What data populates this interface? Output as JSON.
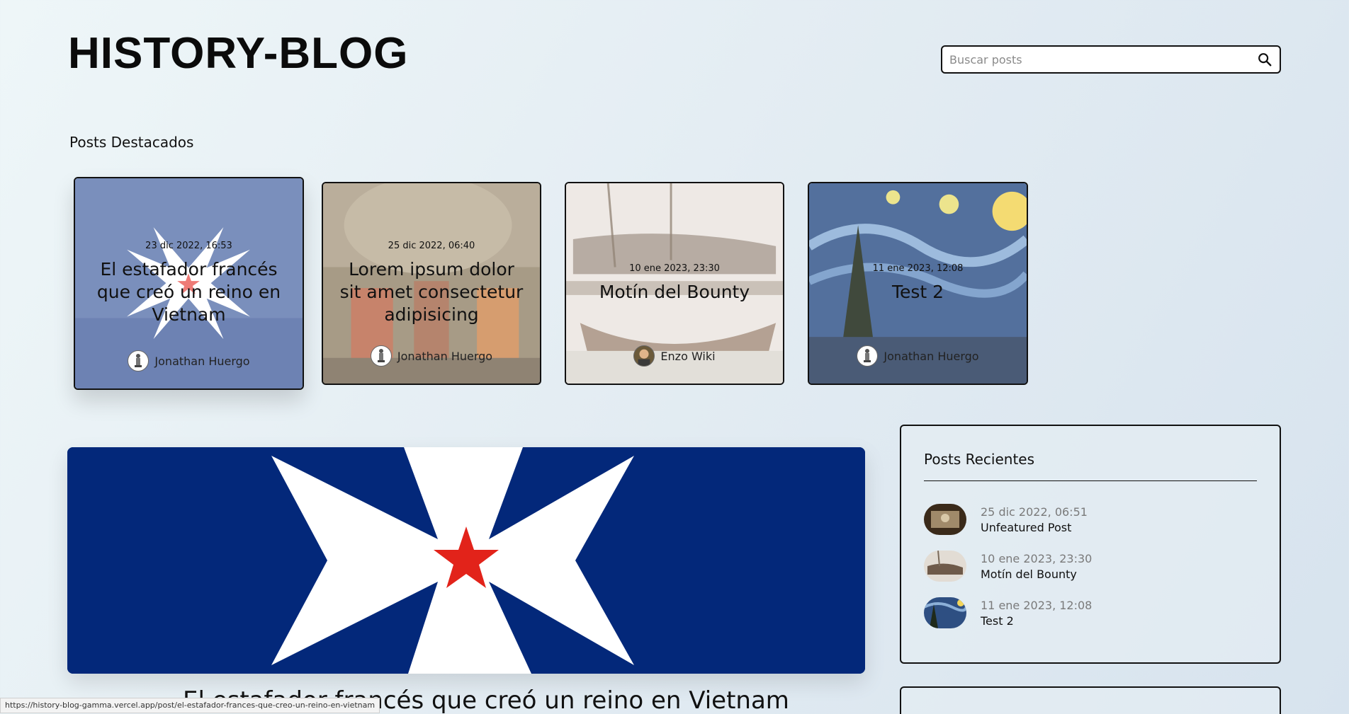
{
  "header": {
    "logo": "HISTORY-BLOG",
    "search_placeholder": "Buscar posts"
  },
  "featured": {
    "title": "Posts Destacados",
    "posts": [
      {
        "date": "23 dic 2022, 16:53",
        "title": "El estafador francés que creó un reino en Vietnam",
        "author": "Jonathan Huergo"
      },
      {
        "date": "25 dic 2022, 06:40",
        "title": "Lorem ipsum dolor sit amet consectetur adipisicing",
        "author": "Jonathan Huergo"
      },
      {
        "date": "10 ene 2023, 23:30",
        "title": "Motín del Bounty",
        "author": "Enzo Wiki"
      },
      {
        "date": "11 ene 2023, 12:08",
        "title": "Test 2",
        "author": "Jonathan Huergo"
      }
    ]
  },
  "main_post": {
    "title": "El estafador francés que creó un reino en Vietnam"
  },
  "recent": {
    "title": "Posts Recientes",
    "items": [
      {
        "date": "25 dic 2022, 06:51",
        "title": "Unfeatured Post"
      },
      {
        "date": "10 ene 2023, 23:30",
        "title": "Motín del Bounty"
      },
      {
        "date": "11 ene 2023, 12:08",
        "title": "Test 2"
      }
    ]
  },
  "status_bar": {
    "url": "https://history-blog-gamma.vercel.app/post/el-estafador-frances-que-creo-un-reino-en-vietnam"
  },
  "colors": {
    "flag_blue": "#03287a",
    "flag_star": "#e2231a",
    "card1_bg": "#7a8fbc"
  }
}
